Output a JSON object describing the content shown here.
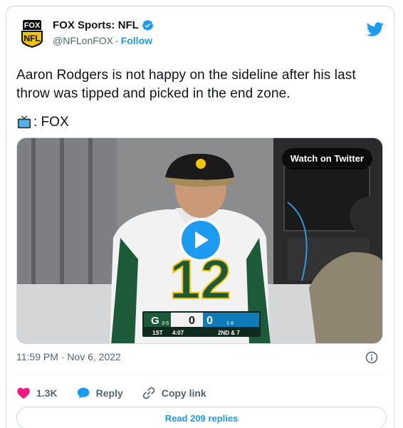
{
  "author": {
    "display_name": "FOX Sports: NFL",
    "handle": "@NFLonFOX",
    "separator": "·",
    "follow_label": "Follow",
    "avatar_logo_top": "FOX",
    "avatar_logo_bottom": "NFL",
    "verified_icon": "verified-badge-icon"
  },
  "tweet": {
    "text": "Aaron Rodgers is not happy on the sideline after his last throw was tipped and picked in the end zone.",
    "credit_label": ": FOX",
    "credit_icon": "tv-icon"
  },
  "media": {
    "watch_label": "Watch on Twitter",
    "play_icon": "play-icon",
    "jersey_number": "12",
    "scorebug": {
      "home_score": "0",
      "away_score": "0",
      "home_record": "3-5",
      "away_record": "1-6",
      "quarter": "1ST",
      "clock": "4:07",
      "down": "2ND & 7"
    }
  },
  "meta": {
    "timestamp": "11:59 PM · Nov 6, 2022"
  },
  "actions": {
    "like_count": "1.3K",
    "reply_label": "Reply",
    "copy_link_label": "Copy link"
  },
  "footer": {
    "read_replies_label": "Read 209 replies"
  },
  "colors": {
    "accent": "#1d9bf0",
    "like": "#f91880",
    "text": "#0f1419",
    "muted": "#536471"
  }
}
